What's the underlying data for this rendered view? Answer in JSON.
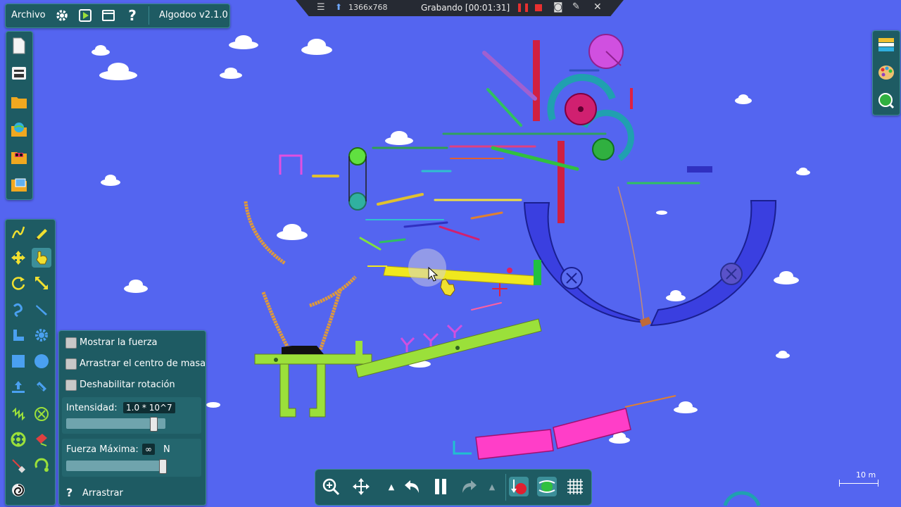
{
  "menu": {
    "file_label": "Archivo",
    "app_version": "Algodoo v2.1.0",
    "icons": [
      "gear-icon",
      "play-scene-icon",
      "window-icon",
      "help-icon"
    ]
  },
  "recorder": {
    "resolution": "1366x768",
    "status": "Grabando [00:01:31]",
    "icons": [
      "menu-icon",
      "pin-icon",
      "pause-icon",
      "stop-icon",
      "camera-icon",
      "pen-icon",
      "close-icon"
    ]
  },
  "left_file_toolbar": {
    "icons": [
      "new-file-icon",
      "printer-icon",
      "folder-open-icon",
      "globe-folder-icon",
      "phunlet-folder-icon",
      "scene-folder-icon"
    ]
  },
  "tools": {
    "icons": [
      "sketch-tool-icon",
      "brush-tool-icon",
      "move-tool-icon",
      "drag-tool-icon",
      "rotate-tool-icon",
      "scale-tool-icon",
      "rope-tool-icon",
      "cutter-tool-icon",
      "plane-tool-icon",
      "gear-tool-icon",
      "box-tool-icon",
      "circle-tool-icon",
      "thruster-tool-icon",
      "chain-tool-icon",
      "spring-tool-icon",
      "fixate-tool-icon",
      "axle-tool-icon",
      "tracer-tool-icon",
      "laser-tool-icon",
      "hinge-tool-icon",
      "spiral-tool-icon"
    ],
    "active": "drag-tool-icon"
  },
  "drag_options": {
    "show_force": "Mostrar la  fuerza",
    "drag_center": "Arrastrar el centro de masa",
    "disable_rotation": "Deshabilitar rotación",
    "intensity_label": "Intensidad:",
    "intensity_value": "1.0 * 10^7",
    "intensity_level": 0.9,
    "max_force_label": "Fuerza Máxima:",
    "max_force_value": "∞",
    "max_force_unit": "N",
    "max_force_level": 1.0,
    "footer_label": "Arrastrar"
  },
  "right_toolbar": {
    "icons": [
      "layers-icon",
      "palette-icon",
      "scene-browser-icon"
    ]
  },
  "bottom_bar": {
    "icons": [
      "zoom-icon",
      "pan-icon",
      "undo-menu-icon",
      "undo-icon",
      "pause-icon",
      "redo-icon",
      "redo-menu-icon",
      "gravity-icon",
      "air-icon",
      "grid-icon"
    ]
  },
  "scale": {
    "label": "10 m"
  },
  "colors": {
    "sky": "#5465f0",
    "panel": "#1e5b63",
    "panel_border": "#3b8a92",
    "accent_yellow": "#f0e81e",
    "accent_lime": "#9be03a",
    "accent_pink": "#ff3ec8",
    "bowl": "#3a3fe0",
    "rope": "#e09a3a"
  }
}
